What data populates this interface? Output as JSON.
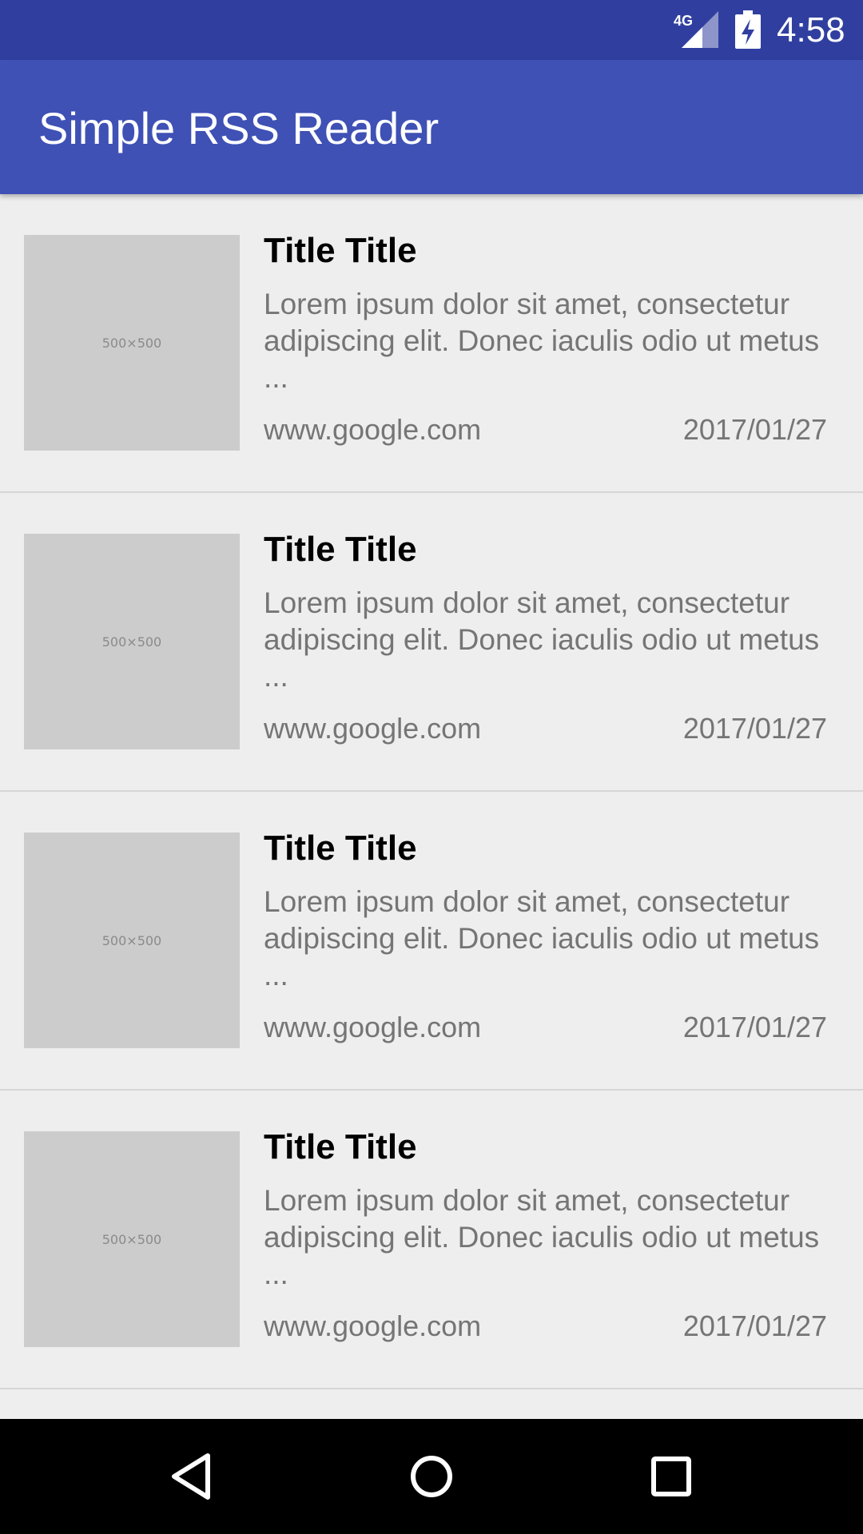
{
  "status_bar": {
    "network": "4G",
    "time": "4:58",
    "icons": [
      "signal-icon",
      "battery-charging-icon"
    ]
  },
  "app_bar": {
    "title": "Simple RSS Reader"
  },
  "feed": {
    "items": [
      {
        "thumbnail_label": "500×500",
        "title": "Title Title",
        "description": "Lorem ipsum dolor sit amet, consectetur adipiscing elit. Donec iaculis odio ut metus ...",
        "source": "www.google.com",
        "date": "2017/01/27"
      },
      {
        "thumbnail_label": "500×500",
        "title": "Title Title",
        "description": "Lorem ipsum dolor sit amet, consectetur adipiscing elit. Donec iaculis odio ut metus ...",
        "source": "www.google.com",
        "date": "2017/01/27"
      },
      {
        "thumbnail_label": "500×500",
        "title": "Title Title",
        "description": "Lorem ipsum dolor sit amet, consectetur adipiscing elit. Donec iaculis odio ut metus ...",
        "source": "www.google.com",
        "date": "2017/01/27"
      },
      {
        "thumbnail_label": "500×500",
        "title": "Title Title",
        "description": "Lorem ipsum dolor sit amet, consectetur adipiscing elit. Donec iaculis odio ut metus ...",
        "source": "www.google.com",
        "date": "2017/01/27"
      }
    ]
  },
  "nav_bar": {
    "buttons": [
      "back-icon",
      "home-icon",
      "recents-icon"
    ]
  },
  "colors": {
    "status_bar": "#303f9f",
    "app_bar": "#3f51b5",
    "background": "#eeeeee",
    "thumbnail": "#cccccc",
    "secondary_text": "#757575",
    "nav_bar": "#000000"
  }
}
